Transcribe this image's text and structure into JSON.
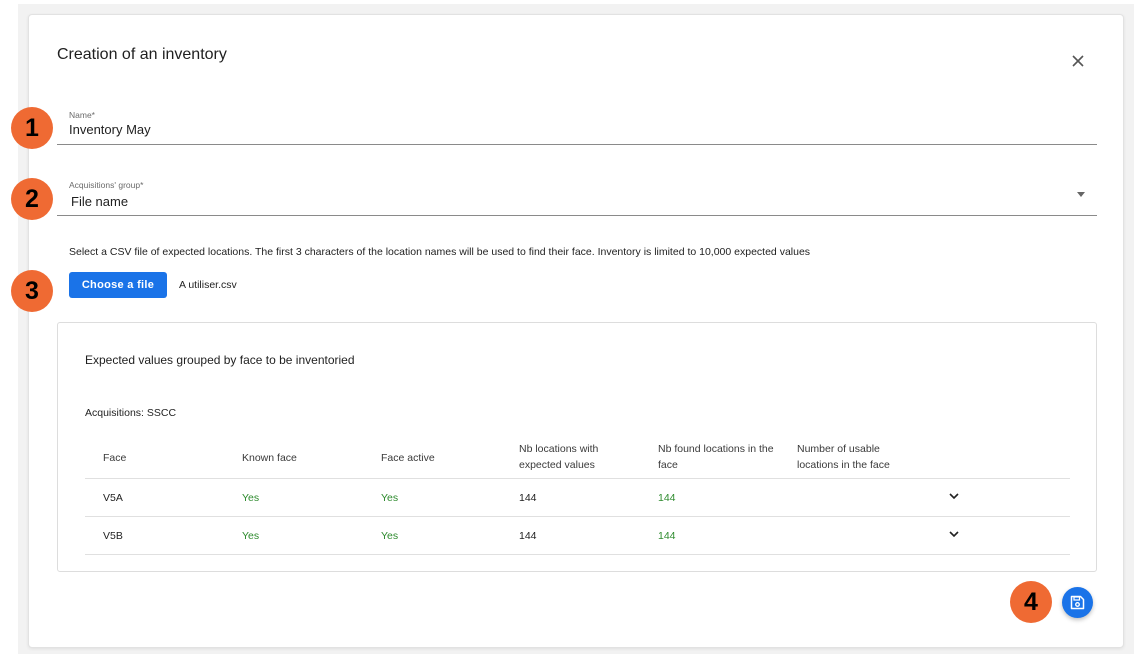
{
  "dialog": {
    "title": "Creation of an inventory"
  },
  "form": {
    "name": {
      "label": "Name*",
      "value": "Inventory May"
    },
    "acquisitions_group": {
      "label": "Acquisitions' group*",
      "value": "File name"
    },
    "csv_hint": "Select a CSV file of expected locations. The first 3 characters of the location names will be used to find their face. Inventory is limited to 10,000 expected values",
    "choose_file_label": "Choose a file",
    "selected_file": "A utiliser.csv"
  },
  "expected": {
    "title": "Expected values grouped by face to be inventoried",
    "acquisitions_label": "Acquisitions: SSCC",
    "columns": [
      "Face",
      "Known face",
      "Face active",
      "Nb locations with expected values",
      "Nb found locations in the face",
      "Number of usable locations in the face"
    ],
    "rows": [
      {
        "face": "V5A",
        "known": "Yes",
        "active": "Yes",
        "expected": "144",
        "found": "144",
        "usable": ""
      },
      {
        "face": "V5B",
        "known": "Yes",
        "active": "Yes",
        "expected": "144",
        "found": "144",
        "usable": ""
      }
    ]
  },
  "annotations": [
    "1",
    "2",
    "3",
    "4"
  ],
  "colors": {
    "primary": "#1a73e8",
    "success": "#2e8b2e",
    "badge": "#ef6a33"
  },
  "icons": {
    "close": "close-icon",
    "dropdown": "caret-down-icon",
    "expand": "chevron-down-icon",
    "save": "floppy-disk-icon"
  }
}
